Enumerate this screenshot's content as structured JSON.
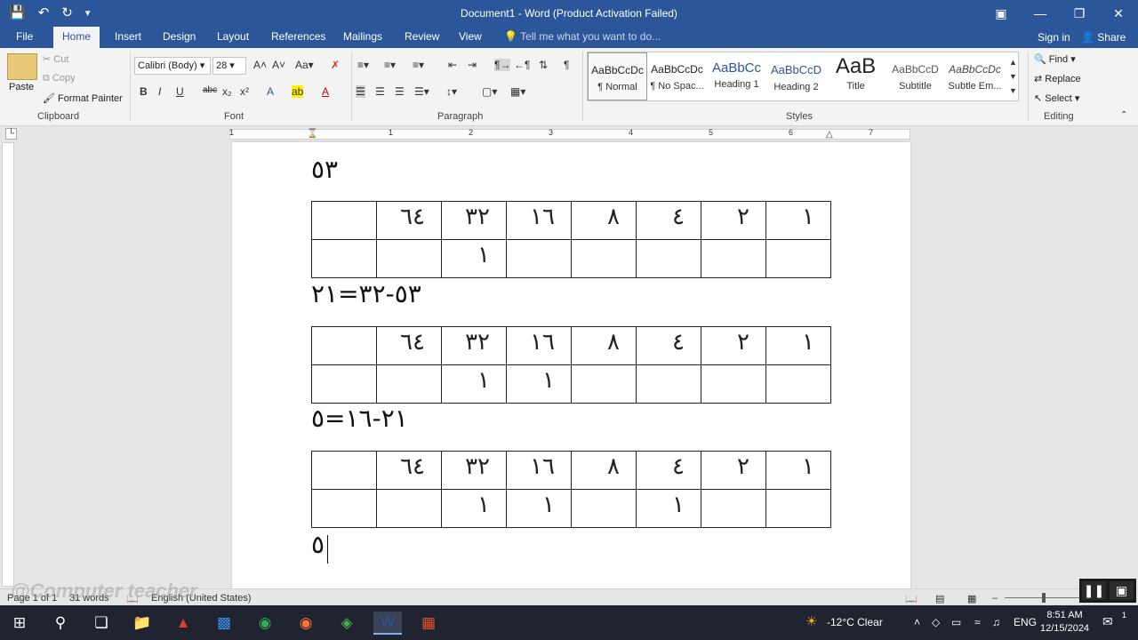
{
  "window": {
    "title": "Document1 - Word (Product Activation Failed)",
    "controls": [
      "restore-ribbon",
      "minimize",
      "maximize",
      "close"
    ]
  },
  "quick_access": [
    "save",
    "undo",
    "redo",
    "customize"
  ],
  "tabs": [
    {
      "label": "File"
    },
    {
      "label": "Home"
    },
    {
      "label": "Insert"
    },
    {
      "label": "Design"
    },
    {
      "label": "Layout"
    },
    {
      "label": "References"
    },
    {
      "label": "Mailings"
    },
    {
      "label": "Review"
    },
    {
      "label": "View"
    }
  ],
  "tell_me": "Tell me what you want to do...",
  "sign_in": "Sign in",
  "share": "Share",
  "clipboard": {
    "paste": "Paste",
    "cut": "Cut",
    "copy": "Copy",
    "format_painter": "Format Painter",
    "label": "Clipboard"
  },
  "font": {
    "name": "Calibri (Body)",
    "size": "28",
    "label": "Font"
  },
  "paragraph": {
    "label": "Paragraph"
  },
  "styles": {
    "label": "Styles",
    "items": [
      {
        "preview": "AaBbCcDc",
        "name": "¶ Normal"
      },
      {
        "preview": "AaBbCcDc",
        "name": "¶ No Spac..."
      },
      {
        "preview": "AaBbCc",
        "name": "Heading 1"
      },
      {
        "preview": "AaBbCcD",
        "name": "Heading 2"
      },
      {
        "preview": "AaB",
        "name": "Title"
      },
      {
        "preview": "AaBbCcD",
        "name": "Subtitle"
      },
      {
        "preview": "AaBbCcDc",
        "name": "Subtle Em..."
      }
    ]
  },
  "editing": {
    "find": "Find",
    "replace": "Replace",
    "select": "Select",
    "label": "Editing"
  },
  "ruler": {
    "numbers": [
      "1",
      "1",
      "2",
      "3",
      "4",
      "5",
      "6",
      "7"
    ]
  },
  "document": {
    "line1": "٥٣",
    "line2": "٥٣-٣٢=٢١",
    "line3": "٢١-١٦=٥",
    "line4": "٥",
    "table_header": [
      "١",
      "٢",
      "٤",
      "٨",
      "١٦",
      "٣٢",
      "٦٤",
      ""
    ],
    "table1_row2": [
      "",
      "",
      "",
      "",
      "",
      "١",
      "",
      ""
    ],
    "table2_row2": [
      "",
      "",
      "",
      "",
      "١",
      "١",
      "",
      ""
    ],
    "table3_row2": [
      "",
      "",
      "١",
      "",
      "١",
      "١",
      "",
      ""
    ]
  },
  "watermark": "@Computer teacher",
  "status": {
    "page": "Page 1 of 1",
    "words": "31 words",
    "language": "English (United States)"
  },
  "taskbar": {
    "weather": "-12°C  Clear",
    "lang": "ENG",
    "time": "8:51 AM",
    "date": "12/15/2024",
    "notification_count": "1"
  }
}
